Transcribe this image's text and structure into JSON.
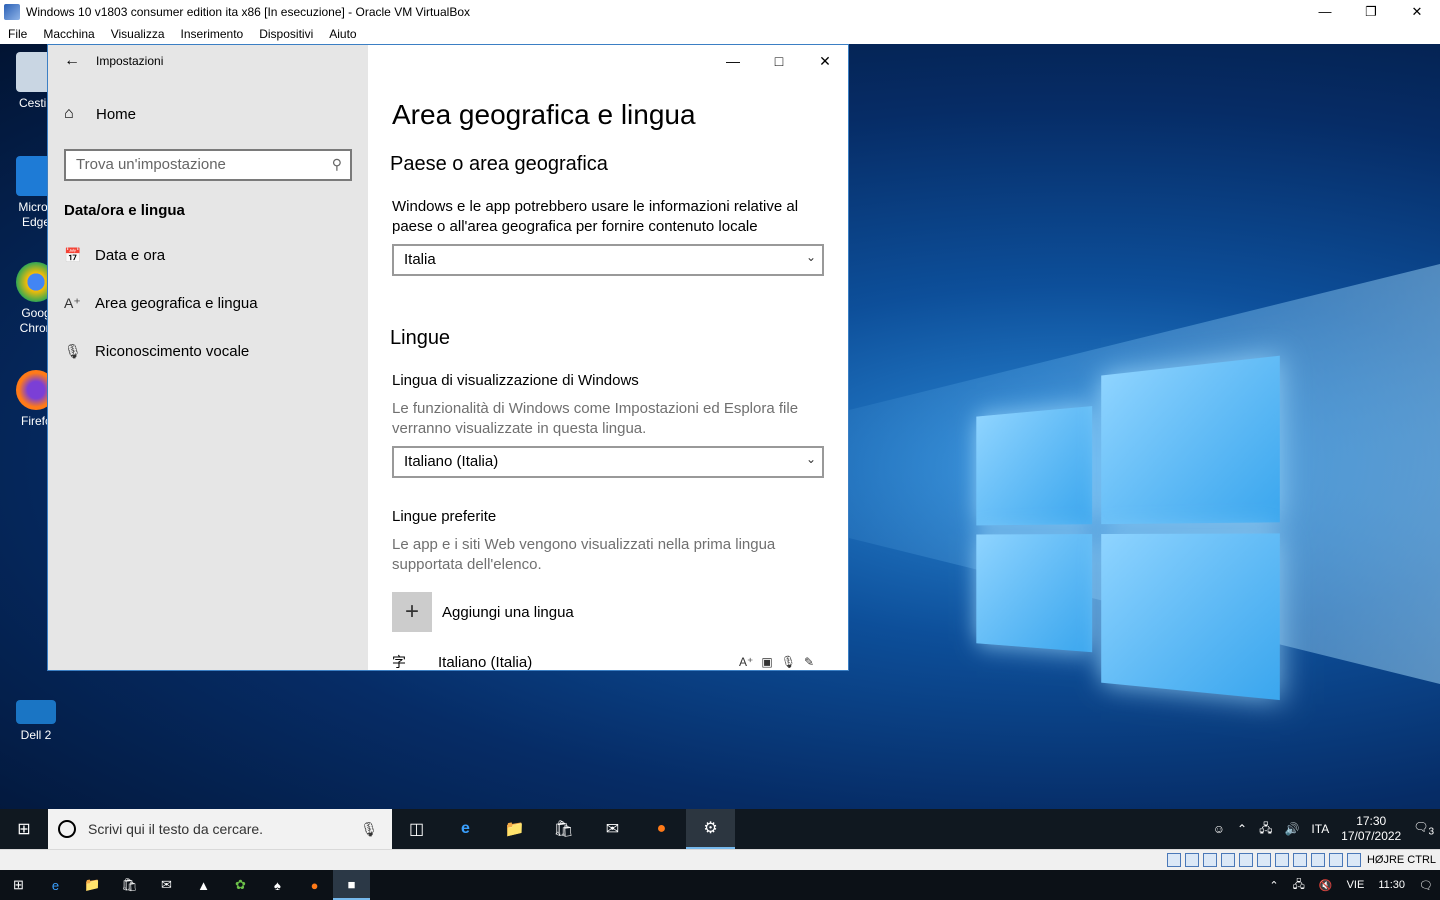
{
  "vbox": {
    "title": "Windows 10 v1803 consumer edition ita x86 [In esecuzione] - Oracle VM VirtualBox",
    "menu": [
      "File",
      "Macchina",
      "Visualizza",
      "Inserimento",
      "Dispositivi",
      "Aiuto"
    ],
    "status_hostkey": "HØJRE CTRL"
  },
  "desktop_icons": [
    "Cestin",
    "Micros\nEdge",
    "Goog\nChron",
    "Firefc",
    "Dell 2"
  ],
  "settings": {
    "window_title": "Impostazioni",
    "home": "Home",
    "search_placeholder": "Trova un'impostazione",
    "section": "Data/ora e lingua",
    "nav": [
      "Data e ora",
      "Area geografica e lingua",
      "Riconoscimento vocale"
    ],
    "page_title": "Area geografica e lingua",
    "country_heading": "Paese o area geografica",
    "country_desc": "Windows e le app potrebbero usare le informazioni relative al paese o all'area geografica per fornire contenuto locale",
    "country_value": "Italia",
    "languages_heading": "Lingue",
    "display_lang_label": "Lingua di visualizzazione di Windows",
    "display_lang_desc": "Le funzionalità di Windows come Impostazioni ed Esplora file verranno visualizzate in questa lingua.",
    "display_lang_value": "Italiano (Italia)",
    "preferred_label": "Lingue preferite",
    "preferred_desc": "Le app e i siti Web vengono visualizzati nella prima lingua supportata dell'elenco.",
    "add_language": "Aggiungi una lingua",
    "lang_item": "Italiano (Italia)"
  },
  "taskbar": {
    "search_placeholder": "Scrivi qui il testo da cercare.",
    "lang": "ITA",
    "time": "17:30",
    "date": "17/07/2022",
    "notif_count": "3"
  },
  "hostbar": {
    "lang": "VIE",
    "time": "11:30"
  }
}
